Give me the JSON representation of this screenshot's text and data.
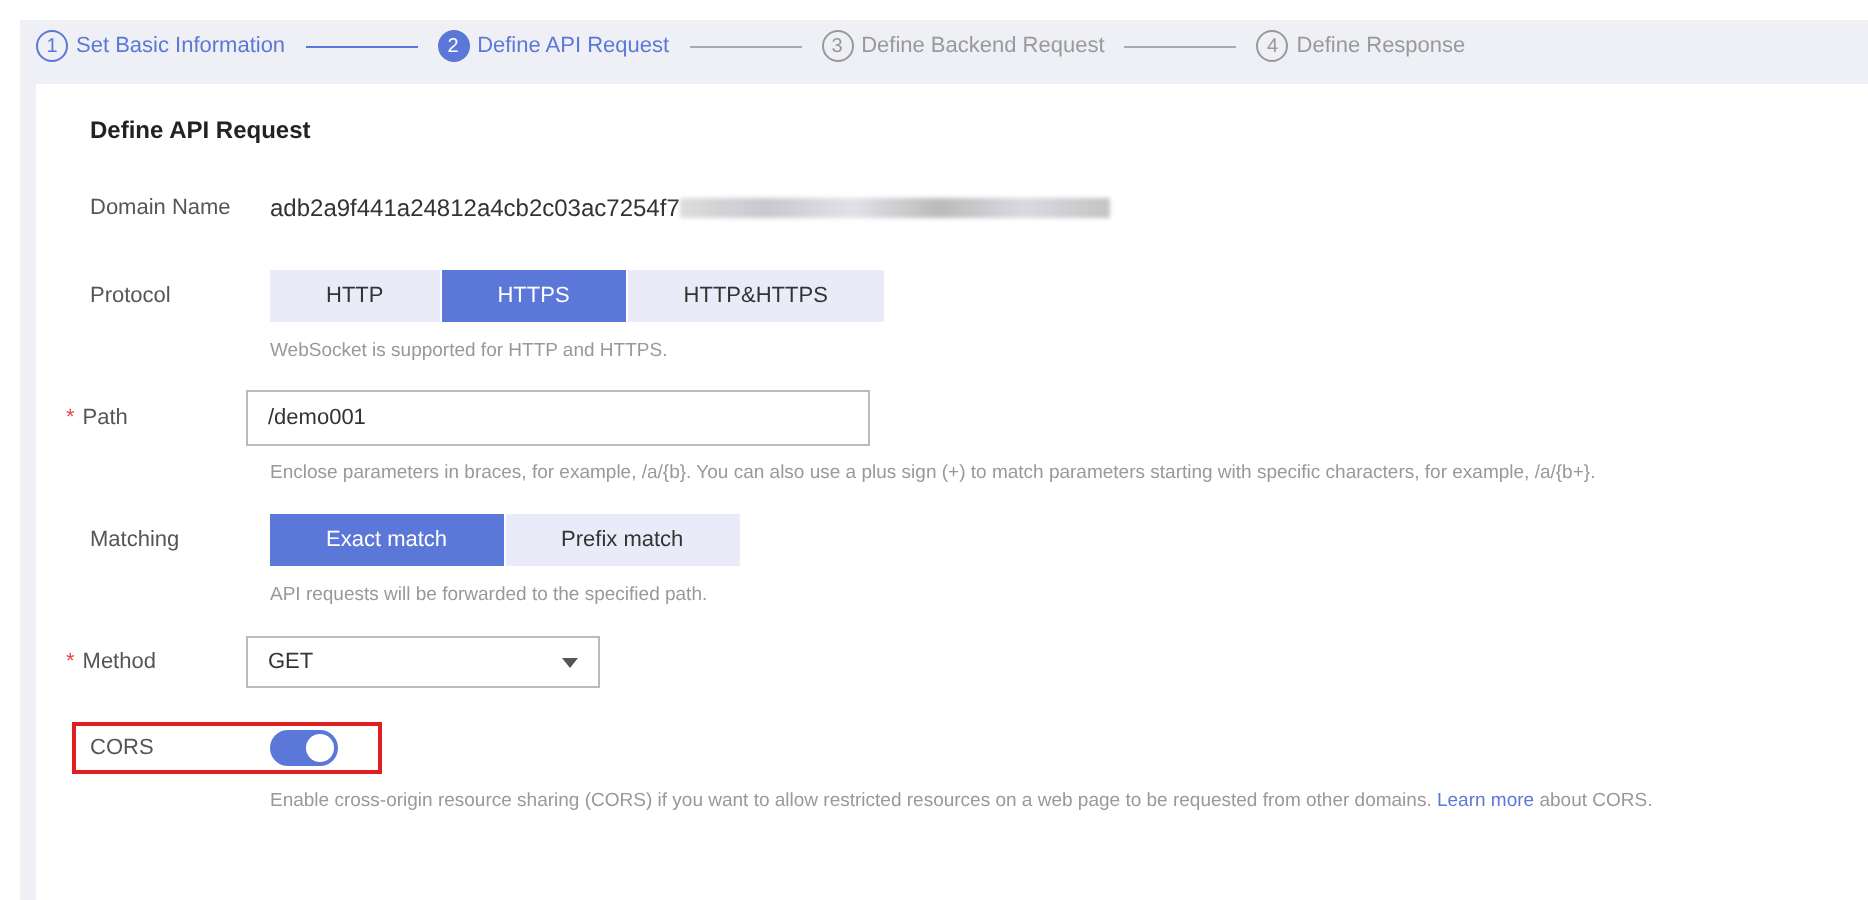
{
  "steps": [
    {
      "number": "1",
      "label": "Set Basic Information",
      "completed": true,
      "selected": false
    },
    {
      "number": "2",
      "label": "Define API Request",
      "completed": false,
      "selected": true
    },
    {
      "number": "3",
      "label": "Define Backend Request",
      "completed": false,
      "selected": false
    },
    {
      "number": "4",
      "label": "Define Response",
      "completed": false,
      "selected": false
    }
  ],
  "section_title": "Define API Request",
  "fields": [
    {
      "kind": "text",
      "label": "Domain Name",
      "value": "adb2a9f441a24812a4cb2c03ac7254f7",
      "redacted": true
    },
    {
      "kind": "segmented",
      "label": "Protocol",
      "options": [
        {
          "label": "HTTP",
          "selected": false
        },
        {
          "label": "HTTPS",
          "selected": true
        },
        {
          "label": "HTTP&HTTPS",
          "selected": false
        }
      ],
      "hint": "WebSocket is supported for HTTP and HTTPS."
    },
    {
      "kind": "input",
      "label": "Path",
      "required_mark": "*",
      "value": "/demo001",
      "hint": "Enclose parameters in braces, for example, /a/{b}. You can also use a plus sign (+) to match parameters starting with specific characters, for example, /a/{b+}."
    },
    {
      "kind": "segmented",
      "label": "Matching",
      "options": [
        {
          "label": "Exact match",
          "selected": true
        },
        {
          "label": "Prefix match",
          "selected": false
        }
      ],
      "hint": "API requests will be forwarded to the specified path."
    },
    {
      "kind": "select",
      "label": "Method",
      "required_mark": "*",
      "value": "GET"
    },
    {
      "kind": "toggle",
      "label": "CORS",
      "on": true,
      "highlighted": true,
      "hint": "Enable cross-origin resource sharing (CORS) if you want to allow restricted resources on a web page to be requested from other domains.",
      "link": "Learn more",
      "hint_after": "about CORS."
    }
  ]
}
